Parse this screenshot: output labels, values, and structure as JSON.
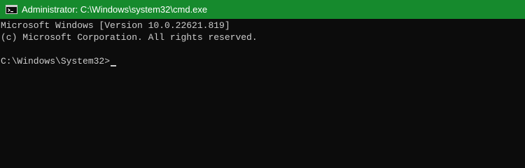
{
  "window": {
    "title": "Administrator: C:\\Windows\\system32\\cmd.exe",
    "titlebar_color": "#168a2d",
    "icon": "cmd-icon"
  },
  "console": {
    "background": "#0c0c0c",
    "foreground": "#cccccc",
    "lines": [
      "Microsoft Windows [Version 10.0.22621.819]",
      "(c) Microsoft Corporation. All rights reserved.",
      ""
    ],
    "prompt": "C:\\Windows\\System32>",
    "input": ""
  }
}
